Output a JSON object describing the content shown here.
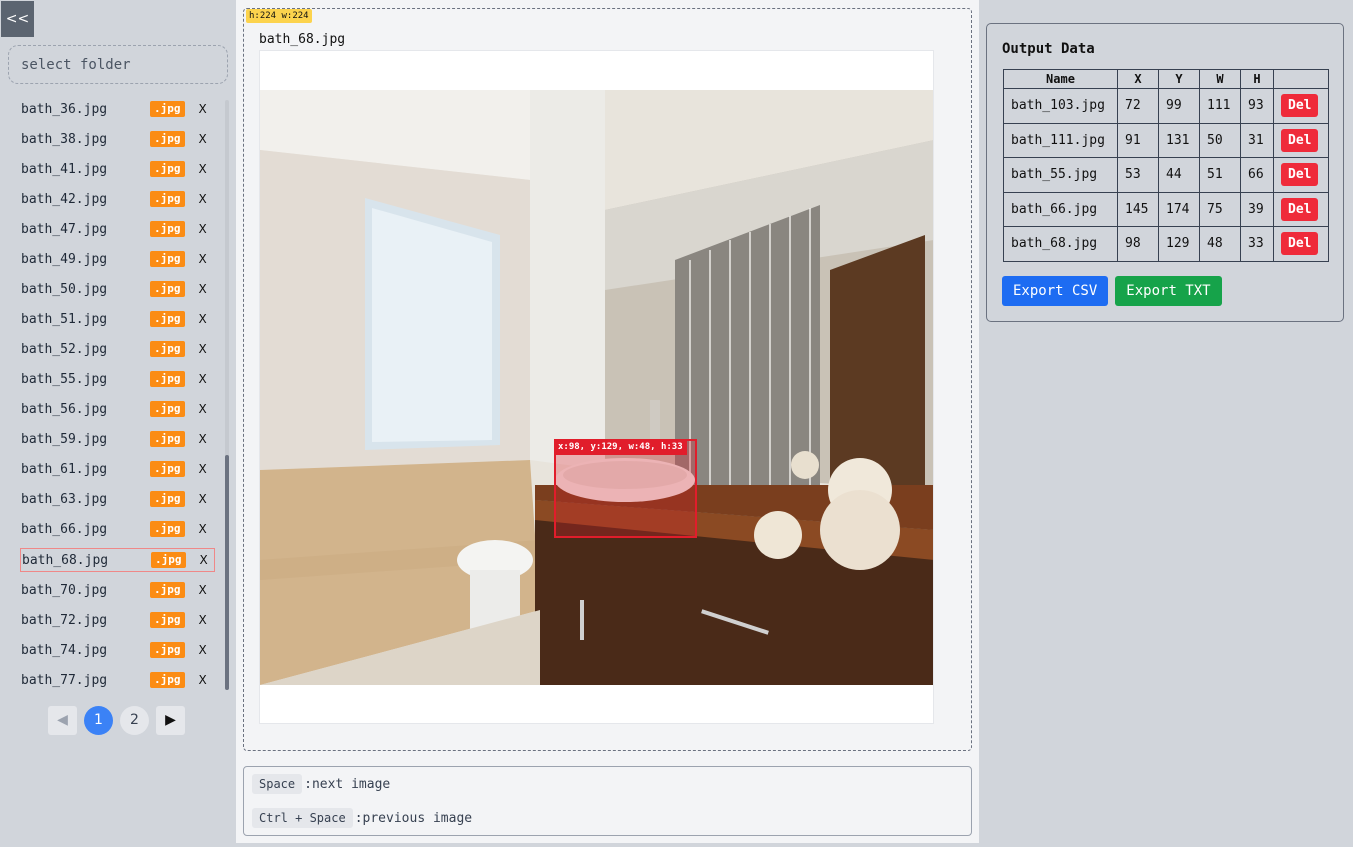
{
  "sidebar": {
    "collapse_label": "<<",
    "folder_placeholder": "select folder",
    "files": [
      {
        "name": "bath_36.jpg",
        "ext": ".jpg",
        "remove": "X"
      },
      {
        "name": "bath_38.jpg",
        "ext": ".jpg",
        "remove": "X"
      },
      {
        "name": "bath_41.jpg",
        "ext": ".jpg",
        "remove": "X"
      },
      {
        "name": "bath_42.jpg",
        "ext": ".jpg",
        "remove": "X"
      },
      {
        "name": "bath_47.jpg",
        "ext": ".jpg",
        "remove": "X"
      },
      {
        "name": "bath_49.jpg",
        "ext": ".jpg",
        "remove": "X"
      },
      {
        "name": "bath_50.jpg",
        "ext": ".jpg",
        "remove": "X"
      },
      {
        "name": "bath_51.jpg",
        "ext": ".jpg",
        "remove": "X"
      },
      {
        "name": "bath_52.jpg",
        "ext": ".jpg",
        "remove": "X"
      },
      {
        "name": "bath_55.jpg",
        "ext": ".jpg",
        "remove": "X"
      },
      {
        "name": "bath_56.jpg",
        "ext": ".jpg",
        "remove": "X"
      },
      {
        "name": "bath_59.jpg",
        "ext": ".jpg",
        "remove": "X"
      },
      {
        "name": "bath_61.jpg",
        "ext": ".jpg",
        "remove": "X"
      },
      {
        "name": "bath_63.jpg",
        "ext": ".jpg",
        "remove": "X"
      },
      {
        "name": "bath_66.jpg",
        "ext": ".jpg",
        "remove": "X"
      },
      {
        "name": "bath_68.jpg",
        "ext": ".jpg",
        "remove": "X",
        "active": true
      },
      {
        "name": "bath_70.jpg",
        "ext": ".jpg",
        "remove": "X"
      },
      {
        "name": "bath_72.jpg",
        "ext": ".jpg",
        "remove": "X"
      },
      {
        "name": "bath_74.jpg",
        "ext": ".jpg",
        "remove": "X"
      },
      {
        "name": "bath_77.jpg",
        "ext": ".jpg",
        "remove": "X"
      }
    ],
    "pagination": {
      "prev": "◀",
      "next": "▶",
      "pages": [
        "1",
        "2"
      ],
      "current": "1"
    }
  },
  "viewer": {
    "dimensions": "h:224 w:224",
    "image_name": "bath_68.jpg",
    "bbox_label": "x:98, y:129, w:48, h:33"
  },
  "shortcuts": [
    {
      "key": "Space",
      "desc": ":next image"
    },
    {
      "key": "Ctrl + Space",
      "desc": ":previous image"
    }
  ],
  "output": {
    "title": "Output Data",
    "columns": [
      "Name",
      "X",
      "Y",
      "W",
      "H",
      ""
    ],
    "rows": [
      {
        "name": "bath_103.jpg",
        "x": "72",
        "y": "99",
        "w": "111",
        "h": "93",
        "action": "Del"
      },
      {
        "name": "bath_111.jpg",
        "x": "91",
        "y": "131",
        "w": "50",
        "h": "31",
        "action": "Del"
      },
      {
        "name": "bath_55.jpg",
        "x": "53",
        "y": "44",
        "w": "51",
        "h": "66",
        "action": "Del"
      },
      {
        "name": "bath_66.jpg",
        "x": "145",
        "y": "174",
        "w": "75",
        "h": "39",
        "action": "Del"
      },
      {
        "name": "bath_68.jpg",
        "x": "98",
        "y": "129",
        "w": "48",
        "h": "33",
        "action": "Del"
      }
    ],
    "export_csv": "Export CSV",
    "export_txt": "Export TXT"
  },
  "colors": {
    "accent_blue": "#1d6cf2",
    "accent_green": "#16a34a",
    "danger": "#ef2b3a",
    "badge_orange": "#fb8c14",
    "bbox_red": "#e11d2b"
  }
}
